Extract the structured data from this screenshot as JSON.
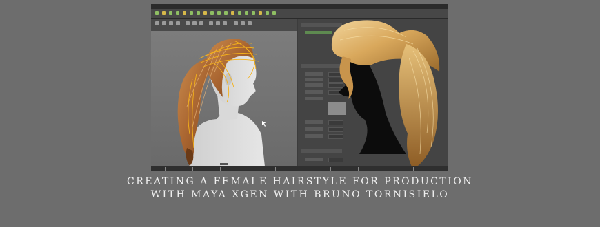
{
  "caption": {
    "line1": "CREATING A FEMALE HAIRSTYLE FOR PRODUCTION",
    "line2": "WITH MAYA XGEN WITH BRUNO TORNISIELO"
  },
  "colors": {
    "page_bg": "#6d6d6d",
    "maya_ui_bg": "#3c3c3c",
    "viewport_bg": "#757575",
    "hair_light": "#e9c27a",
    "hair_dark": "#8a4f22",
    "guide_curves": "#f5b21a",
    "caption_text": "#f0f0f0"
  },
  "screenshot": {
    "app": "Autodesk Maya XGen",
    "left_view": "viewport with hair guides on mannequin",
    "right_view": "rendered blonde ponytail silhouette"
  }
}
